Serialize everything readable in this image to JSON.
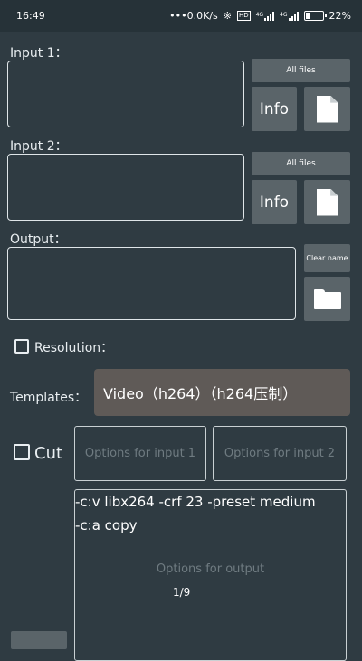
{
  "status_bar": {
    "time": "16:49",
    "network_speed": "•••0.0K/s",
    "net_type_1": "4G",
    "net_type_2": "4G",
    "hd": "HD",
    "battery": "22%"
  },
  "input1": {
    "label": "Input 1：",
    "value": "",
    "all_files": "All files",
    "info": "Info"
  },
  "input2": {
    "label": "Input 2：",
    "value": "",
    "all_files": "All files",
    "info": "Info"
  },
  "output": {
    "label": "Output：",
    "value": "",
    "clear_name": "Clear name"
  },
  "resolution": {
    "label": "Resolution：",
    "checked": false
  },
  "templates": {
    "label": "Templates：",
    "selected": "Video（h264）（h264压制）"
  },
  "cut": {
    "label": "Cut",
    "checked": false
  },
  "options": {
    "input1_placeholder": "Options for input 1",
    "input2_placeholder": "Options for input 2",
    "output_lines": [
      "-c:v libx264 -crf 23 -preset medium",
      "-c:a copy"
    ],
    "output_placeholder": "Options for output",
    "page_indicator": "1/9"
  },
  "icons": {
    "file": "file-icon",
    "folder": "folder-icon",
    "bluetooth": "bluetooth-icon",
    "signal": "signal-icon",
    "battery": "battery-icon"
  }
}
